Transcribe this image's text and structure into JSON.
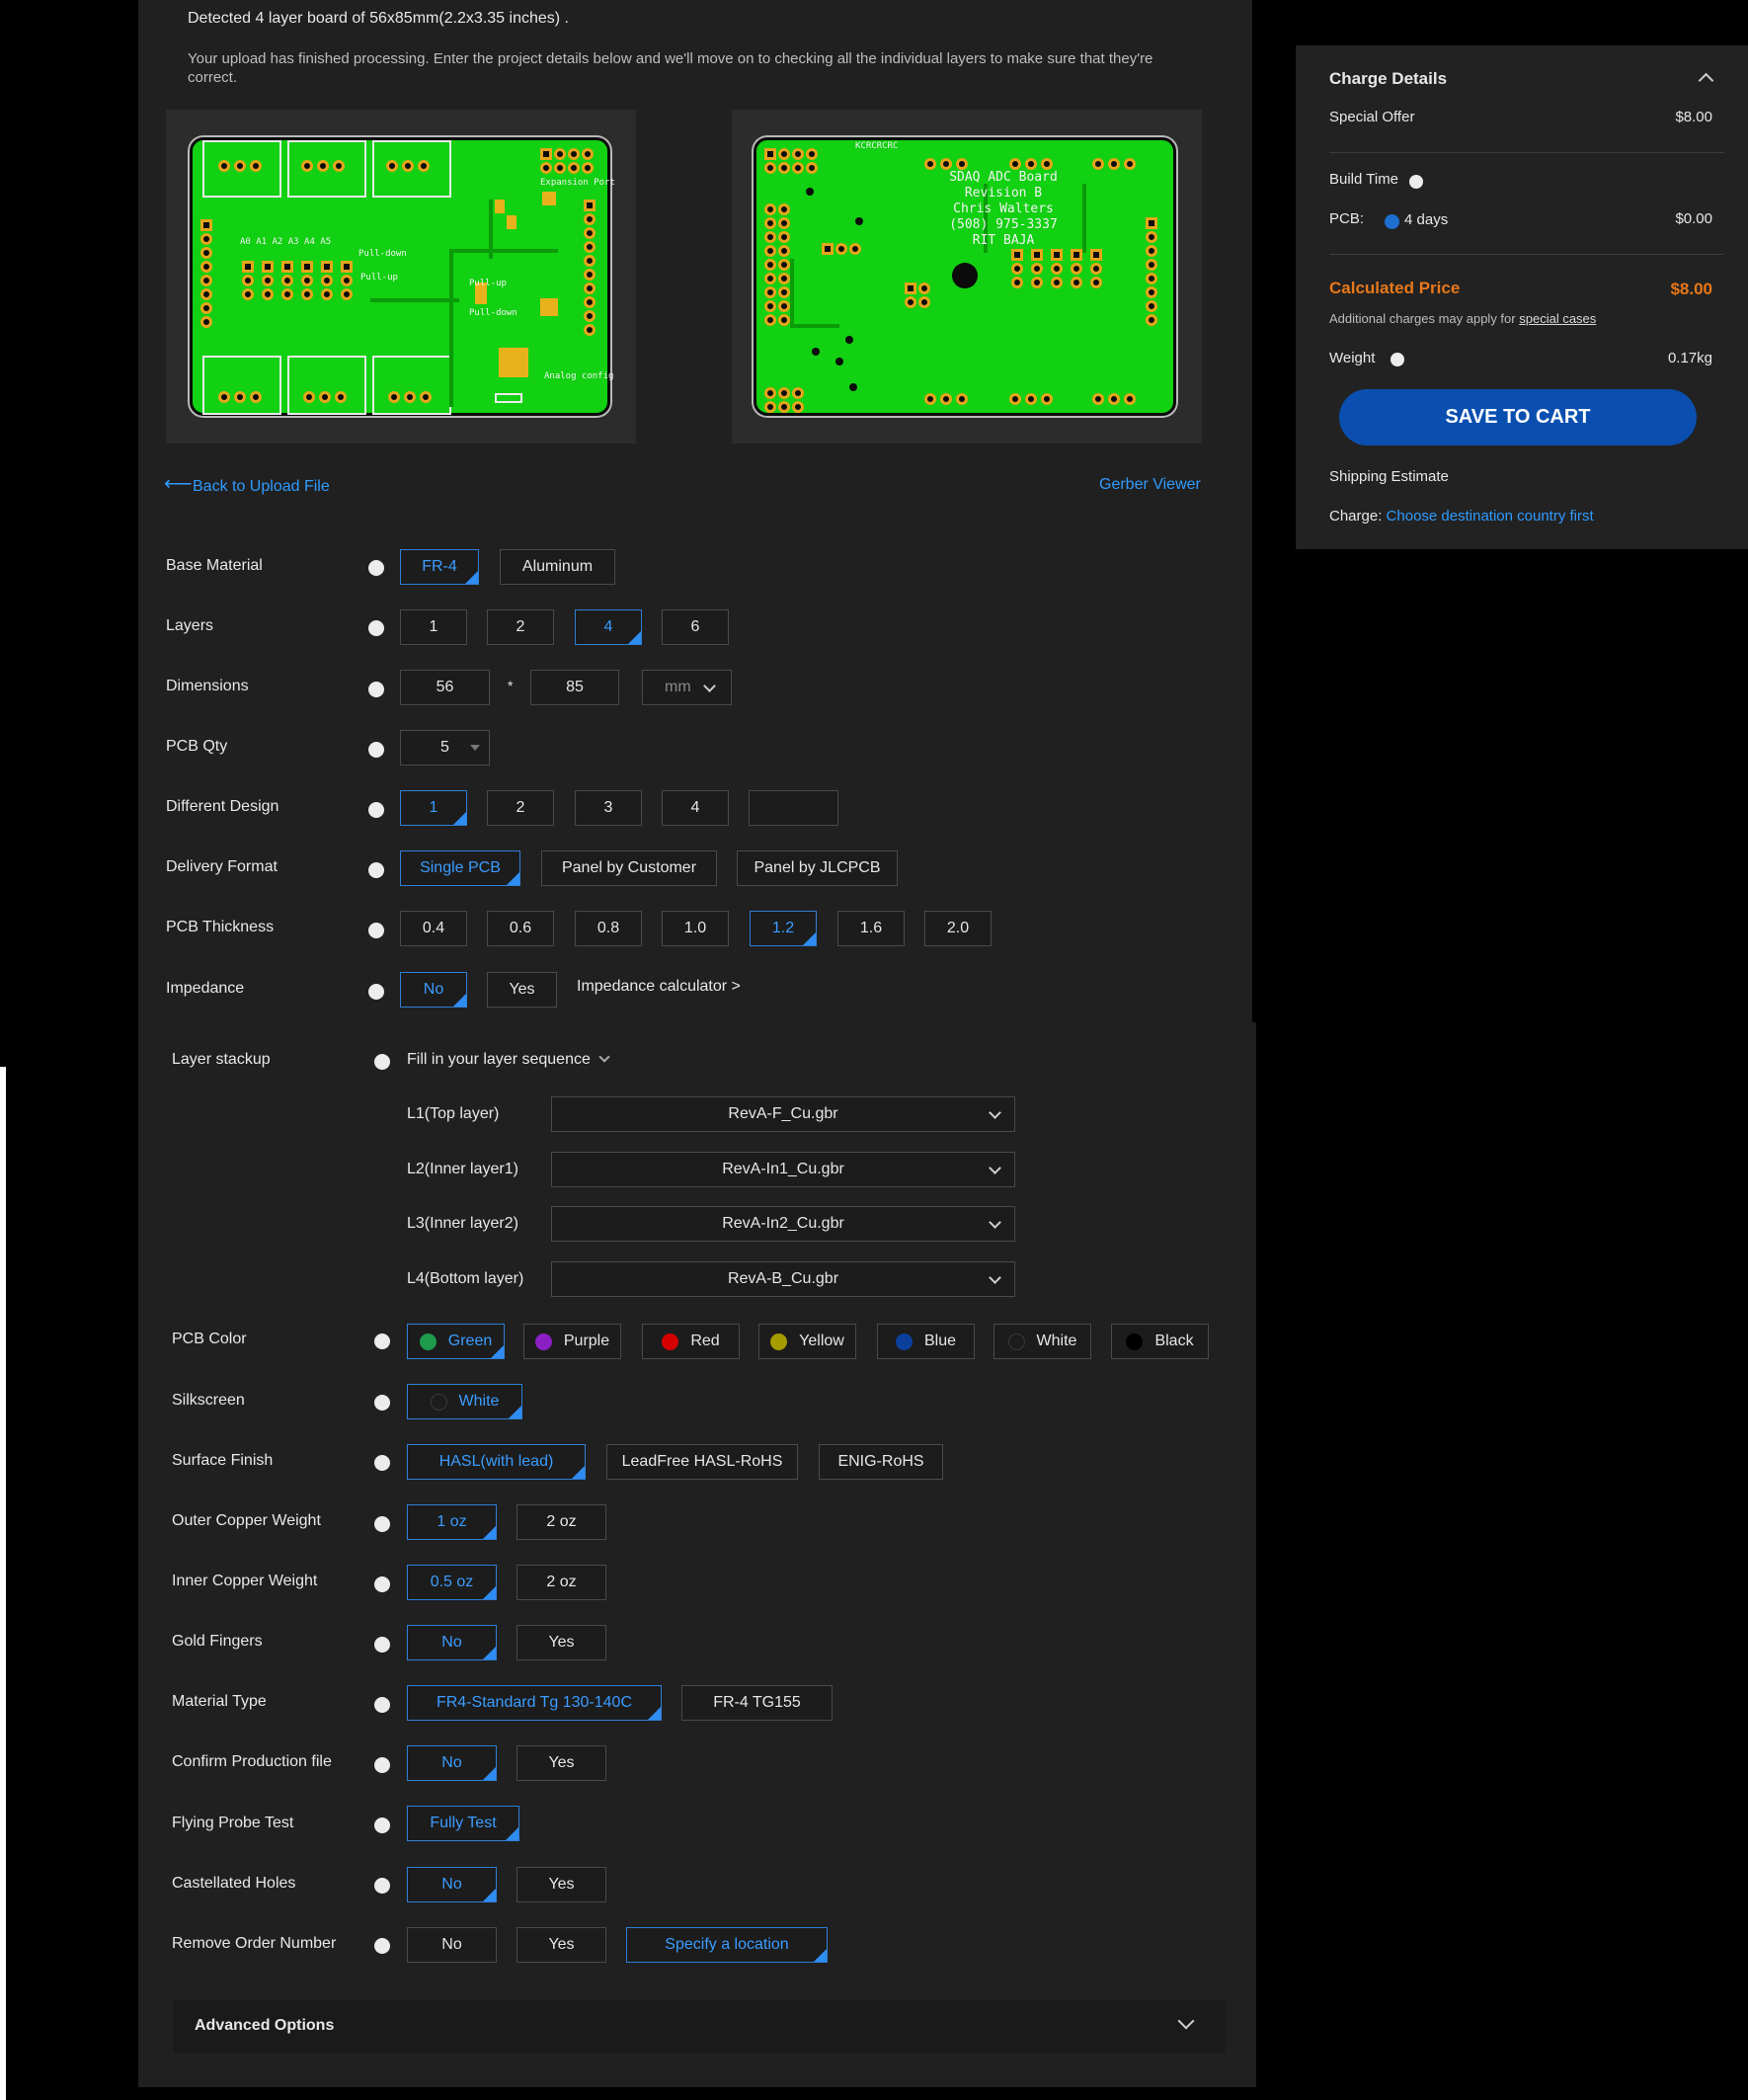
{
  "header": {
    "detected": "Detected 4 layer board of 56x85mm(2.2x3.35 inches) .",
    "notice": "Your upload has finished processing. Enter the project details below and we'll move on to checking all the individual layers to make sure that they're correct."
  },
  "preview": {
    "top_labels": {
      "expansion": "Expansion Port",
      "analog": "A0  A1  A2  A3  A4  A5",
      "pulldown": "Pull-down",
      "pullup": "Pull-up",
      "pullup2": "Pull-up",
      "pulldown2": "Pull-down",
      "analog_cfg": "Analog config"
    },
    "bottom_silk": "SDAQ ADC Board\nRevision B\nChris Walters\n(508) 975-3337\nRIT BAJA",
    "bottom_part": "KCRCRCRC"
  },
  "nav": {
    "back_label": "Back to Upload File",
    "gerber_label": "Gerber Viewer"
  },
  "options": {
    "base_material": {
      "label": "Base Material",
      "choices": [
        "FR-4",
        "Aluminum"
      ],
      "selected": "FR-4"
    },
    "layers": {
      "label": "Layers",
      "choices": [
        "1",
        "2",
        "4",
        "6"
      ],
      "selected": "4"
    },
    "dimensions": {
      "label": "Dimensions",
      "width": "56",
      "sep": "*",
      "height": "85",
      "unit": "mm"
    },
    "pcb_qty": {
      "label": "PCB Qty",
      "value": "5"
    },
    "different_design": {
      "label": "Different Design",
      "choices": [
        "1",
        "2",
        "3",
        "4"
      ],
      "selected": "1"
    },
    "delivery_format": {
      "label": "Delivery Format",
      "choices": [
        "Single PCB",
        "Panel by Customer",
        "Panel by JLCPCB"
      ],
      "selected": "Single PCB"
    },
    "pcb_thickness": {
      "label": "PCB Thickness",
      "choices": [
        "0.4",
        "0.6",
        "0.8",
        "1.0",
        "1.2",
        "1.6",
        "2.0"
      ],
      "selected": "1.2"
    },
    "impedance": {
      "label": "Impedance",
      "choices": [
        "No",
        "Yes"
      ],
      "selected": "No",
      "calculator": "Impedance calculator >"
    },
    "layer_stackup": {
      "label": "Layer stackup",
      "hint": "Fill in your layer sequence",
      "layers": [
        {
          "name": "L1(Top layer)",
          "file": "RevA-F_Cu.gbr"
        },
        {
          "name": "L2(Inner layer1)",
          "file": "RevA-In1_Cu.gbr"
        },
        {
          "name": "L3(Inner layer2)",
          "file": "RevA-In2_Cu.gbr"
        },
        {
          "name": "L4(Bottom layer)",
          "file": "RevA-B_Cu.gbr"
        }
      ]
    },
    "pcb_color": {
      "label": "PCB Color",
      "choices": [
        {
          "name": "Green",
          "color": "#1e9a4c"
        },
        {
          "name": "Purple",
          "color": "#8a1fc4"
        },
        {
          "name": "Red",
          "color": "#d40000"
        },
        {
          "name": "Yellow",
          "color": "#a59d00"
        },
        {
          "name": "Blue",
          "color": "#0a3f9c"
        },
        {
          "name": "White",
          "color": "#1c1c1c"
        },
        {
          "name": "Black",
          "color": "#000000"
        }
      ],
      "selected": "Green"
    },
    "silkscreen": {
      "label": "Silkscreen",
      "choices": [
        "White"
      ],
      "selected": "White"
    },
    "surface_finish": {
      "label": "Surface Finish",
      "choices": [
        "HASL(with lead)",
        "LeadFree HASL-RoHS",
        "ENIG-RoHS"
      ],
      "selected": "HASL(with lead)"
    },
    "outer_copper": {
      "label": "Outer Copper Weight",
      "choices": [
        "1 oz",
        "2 oz"
      ],
      "selected": "1 oz"
    },
    "inner_copper": {
      "label": "Inner Copper Weight",
      "choices": [
        "0.5 oz",
        "2 oz"
      ],
      "selected": "0.5 oz"
    },
    "gold_fingers": {
      "label": "Gold Fingers",
      "choices": [
        "No",
        "Yes"
      ],
      "selected": "No"
    },
    "material_type": {
      "label": "Material Type",
      "choices": [
        "FR4-Standard Tg 130-140C",
        "FR-4 TG155"
      ],
      "selected": "FR4-Standard Tg 130-140C"
    },
    "confirm_production": {
      "label": "Confirm Production file",
      "choices": [
        "No",
        "Yes"
      ],
      "selected": "No"
    },
    "flying_probe": {
      "label": "Flying Probe Test",
      "choices": [
        "Fully Test"
      ],
      "selected": "Fully Test"
    },
    "castellated": {
      "label": "Castellated Holes",
      "choices": [
        "No",
        "Yes"
      ],
      "selected": "No"
    },
    "remove_order": {
      "label": "Remove Order Number",
      "choices": [
        "No",
        "Yes",
        "Specify a location"
      ],
      "selected": "Specify a location"
    }
  },
  "advanced": {
    "label": "Advanced Options"
  },
  "charge": {
    "title": "Charge Details",
    "special_offer_label": "Special Offer",
    "special_offer_value": "$8.00",
    "build_time_label": "Build Time",
    "pcb_label": "PCB:",
    "pcb_days": "4 days",
    "pcb_value": "$0.00",
    "calc_label": "Calculated Price",
    "calc_value": "$8.00",
    "additional_prefix": "Additional charges may apply for",
    "additional_link": "special cases",
    "weight_label": "Weight",
    "weight_value": "0.17kg",
    "save_button": "SAVE TO CART",
    "shipping_label": "Shipping Estimate",
    "charge_label": "Charge:",
    "charge_link": "Choose destination country first",
    "accent": "#e8781a",
    "button_color": "#0a4fb0"
  }
}
